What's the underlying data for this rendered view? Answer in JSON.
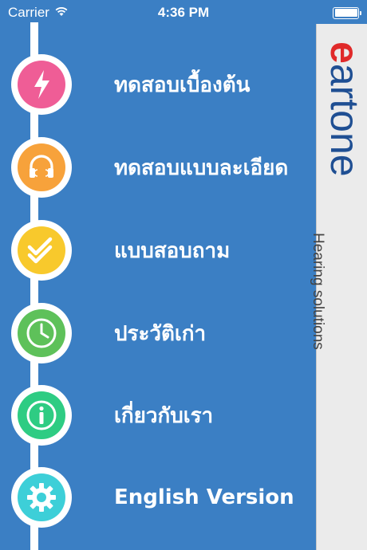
{
  "status_bar": {
    "carrier": "Carrier",
    "time": "4:36 PM"
  },
  "menu": {
    "items": [
      {
        "label": "ทดสอบเบื้องต้น",
        "icon": "lightning-icon",
        "color": "#ef5d96"
      },
      {
        "label": "ทดสอบแบบละเอียด",
        "icon": "headphones-icon",
        "color": "#f7a23b"
      },
      {
        "label": "แบบสอบถาม",
        "icon": "checkmarks-icon",
        "color": "#f8c92c"
      },
      {
        "label": "ประวัติเก่า",
        "icon": "clock-icon",
        "color": "#5ec15a"
      },
      {
        "label": "เกี่ยวกับเรา",
        "icon": "info-icon",
        "color": "#2ecc83"
      },
      {
        "label": "English Version",
        "icon": "gear-icon",
        "color": "#3dcfd8"
      }
    ]
  },
  "brand": {
    "logo_e": "e",
    "logo_rest": "artone",
    "tagline": "Hearing solutions",
    "accent_red": "#e02a2a",
    "accent_blue": "#1f4f93"
  }
}
